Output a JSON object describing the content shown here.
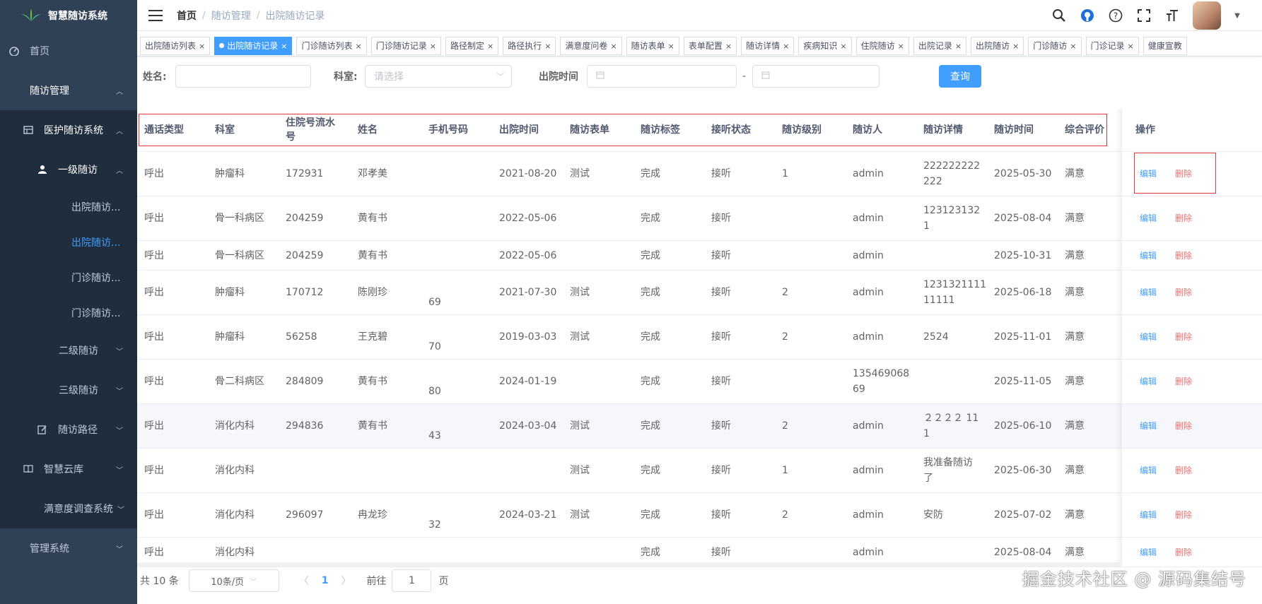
{
  "app": {
    "title": "智慧随访系统"
  },
  "sidebar": {
    "items": [
      {
        "label": "首页"
      },
      {
        "label": "随访管理"
      },
      {
        "label": "医护随访系统"
      },
      {
        "label": "一级随访"
      },
      {
        "label": "出院随访..."
      },
      {
        "label": "出院随访..."
      },
      {
        "label": "门诊随访..."
      },
      {
        "label": "门诊随访..."
      },
      {
        "label": "二级随访"
      },
      {
        "label": "三级随访"
      },
      {
        "label": "随访路径"
      },
      {
        "label": "智慧云库"
      },
      {
        "label": "满意度调查系统"
      },
      {
        "label": "管理系统"
      }
    ]
  },
  "breadcrumb": [
    "首页",
    "随访管理",
    "出院随访记录"
  ],
  "tags": [
    "出院随访列表",
    "出院随访记录",
    "门诊随访列表",
    "门诊随访记录",
    "路径制定",
    "路径执行",
    "满意度问卷",
    "随访表单",
    "表单配置",
    "随访详情",
    "疾病知识",
    "住院随访",
    "出院记录",
    "出院随访",
    "门诊随访",
    "门诊记录",
    "健康宣教"
  ],
  "form": {
    "name_label": "姓名:",
    "dept_label": "科室:",
    "dept_placeholder": "请选择",
    "discharge_label": "出院时间",
    "range_sep": "-",
    "search_button": "查询"
  },
  "table": {
    "headers": [
      "通话类型",
      "科室",
      "住院号流水号",
      "姓名",
      "手机号码",
      "出院时间",
      "随访表单",
      "随访标签",
      "接听状态",
      "随访级别",
      "随访人",
      "随访详情",
      "随访时间",
      "综合评价",
      "操作"
    ],
    "headers_wrapped": {
      "2": [
        "住院号流水",
        "号"
      ]
    },
    "rows": [
      {
        "type": "呼出",
        "dept": "肿瘤科",
        "no": "172931",
        "name": "邓孝美",
        "phone": "",
        "date": "2021-08-20",
        "form": "测试",
        "tag": "完成",
        "status": "接听",
        "level": "1",
        "user": "admin",
        "detail": [
          "222222222",
          "222"
        ],
        "time": "2025-05-30",
        "eval": "满意"
      },
      {
        "type": "呼出",
        "dept": "骨一科病区",
        "no": "204259",
        "name": "黄有书",
        "phone": "",
        "date": "2022-05-06",
        "form": "",
        "tag": "完成",
        "status": "接听",
        "level": "",
        "user": "admin",
        "detail": [
          "123123132",
          "1"
        ],
        "time": "2025-08-04",
        "eval": "满意"
      },
      {
        "type": "呼出",
        "dept": "骨一科病区",
        "no": "204259",
        "name": "黄有书",
        "phone": "",
        "date": "2022-05-06",
        "form": "",
        "tag": "完成",
        "status": "接听",
        "level": "",
        "user": "admin",
        "detail": [],
        "time": "2025-10-31",
        "eval": "满意"
      },
      {
        "type": "呼出",
        "dept": "肿瘤科",
        "no": "170712",
        "name": "陈刚珍",
        "phone": "69",
        "date": "2021-07-30",
        "form": "测试",
        "tag": "完成",
        "status": "接听",
        "level": "2",
        "user": "admin",
        "detail": [
          "1231321111",
          "11111"
        ],
        "time": "2025-06-18",
        "eval": "满意"
      },
      {
        "type": "呼出",
        "dept": "肿瘤科",
        "no": "56258",
        "name": "王克碧",
        "phone": "70",
        "date": "2019-03-03",
        "form": "测试",
        "tag": "完成",
        "status": "接听",
        "level": "2",
        "user": "admin",
        "detail": [
          "2524"
        ],
        "time": "2025-11-01",
        "eval": "满意"
      },
      {
        "type": "呼出",
        "dept": "骨二科病区",
        "no": "284809",
        "name": "黄有书",
        "phone": "80",
        "date": "2024-01-19",
        "form": "",
        "tag": "完成",
        "status": "接听",
        "level": "",
        "user": [
          "135469068",
          "69"
        ],
        "detail": [],
        "time": "2025-11-05",
        "eval": "满意"
      },
      {
        "type": "呼出",
        "dept": "消化内科",
        "no": "294836",
        "name": "黄有书",
        "phone": "43",
        "date": "2024-03-04",
        "form": "测试",
        "tag": "完成",
        "status": "接听",
        "level": "2",
        "user": "admin",
        "detail": [
          "２２２２ 11",
          "1"
        ],
        "time": "2025-06-10",
        "eval": "满意"
      },
      {
        "type": "呼出",
        "dept": "消化内科",
        "no": "",
        "name": "",
        "phone": "",
        "date": "",
        "form": "测试",
        "tag": "完成",
        "status": "接听",
        "level": "1",
        "user": "admin",
        "detail": [
          "我准备随访",
          "了"
        ],
        "time": "2025-06-30",
        "eval": "满意"
      },
      {
        "type": "呼出",
        "dept": "消化内科",
        "no": "296097",
        "name": "冉龙珍",
        "phone": "32",
        "date": "2024-03-21",
        "form": "测试",
        "tag": "完成",
        "status": "接听",
        "level": "2",
        "user": "admin",
        "detail": [
          "安防"
        ],
        "time": "2025-07-02",
        "eval": "满意"
      },
      {
        "type": "呼出",
        "dept": "消化内科",
        "no": "",
        "name": "",
        "phone": "",
        "date": "",
        "form": "",
        "tag": "完成",
        "status": "接听",
        "level": "",
        "user": "admin",
        "detail": [],
        "time": "2025-08-04",
        "eval": "满意"
      }
    ],
    "op_edit": "编辑",
    "op_delete": "删除"
  },
  "pager": {
    "total": "共 10 条",
    "page_size": "10条/页",
    "current": "1",
    "goto_label": "前往",
    "goto_value": "1",
    "goto_suffix": "页"
  },
  "watermark": "掘金技术社区 @ 源码集结号",
  "colors": {
    "sidebar_bg": "#304156",
    "primary": "#409eff",
    "danger": "#f56c6c",
    "highlight_box": "#e0383e"
  }
}
